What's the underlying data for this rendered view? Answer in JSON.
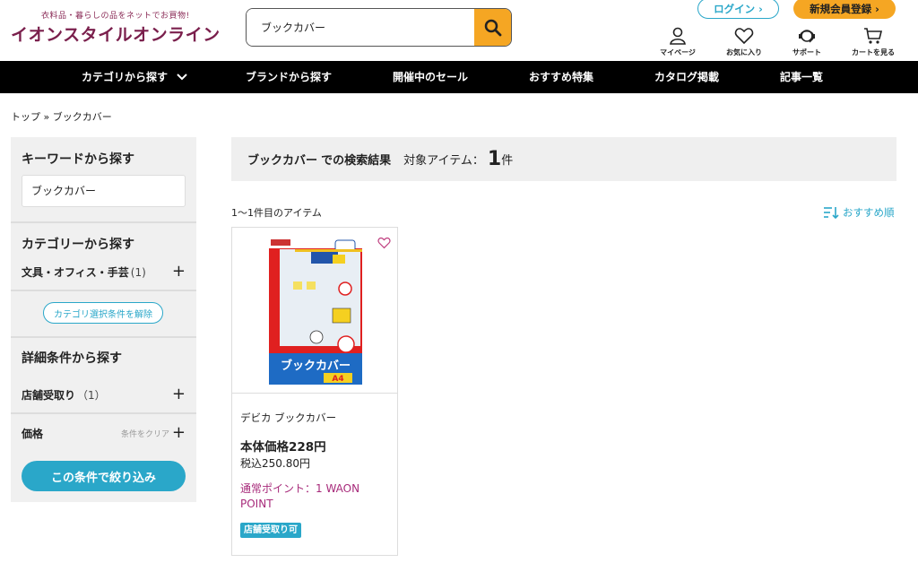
{
  "header": {
    "tagline": "衣料品・暮らしの品をネットでお買物!",
    "logo": "イオンスタイルオンライン",
    "search_value": "ブックカバー",
    "login_label": "ログイン ›",
    "register_label": "新規会員登録 ›",
    "utilities": [
      {
        "label": "マイページ",
        "icon": "user-icon"
      },
      {
        "label": "お気に入り",
        "icon": "heart-icon"
      },
      {
        "label": "サポート",
        "icon": "support-icon"
      },
      {
        "label": "カートを見る",
        "icon": "cart-icon"
      }
    ]
  },
  "nav": {
    "items": [
      "カテゴリから探す",
      "ブランドから探す",
      "開催中のセール",
      "おすすめ特集",
      "カタログ掲載",
      "記事一覧"
    ]
  },
  "breadcrumb": "トップ » ブックカバー",
  "sidebar": {
    "keyword_heading": "キーワードから探す",
    "keyword_value": "ブックカバー",
    "category_heading": "カテゴリーから探す",
    "category_item": "文具・オフィス・手芸",
    "category_count": "(1)",
    "clear_category": "カテゴリ選択条件を解除",
    "detail_heading": "詳細条件から探す",
    "store_pickup": "店舗受取り",
    "store_pickup_count": "（1）",
    "price": "価格",
    "clear_conditions": "条件をクリア",
    "filter_button": "この条件で絞り込み"
  },
  "results": {
    "query": "ブックカバー",
    "query_suffix": "での検索結果",
    "target_label": "対象アイテム：",
    "count": "1",
    "count_unit": "件",
    "range": "1〜1件目のアイテム",
    "sort_label": "おすすめ順"
  },
  "product": {
    "name": "デビカ ブックカバー",
    "price": "本体価格228円",
    "tax_price": "税込250.80円",
    "points": "通常ポイント：1 WAON POINT",
    "badge": "店舗受取り可"
  },
  "colors": {
    "brand": "#7a1f4c",
    "accent": "#2aa7c9",
    "orange": "#f5a623",
    "point": "#a72a7a"
  }
}
